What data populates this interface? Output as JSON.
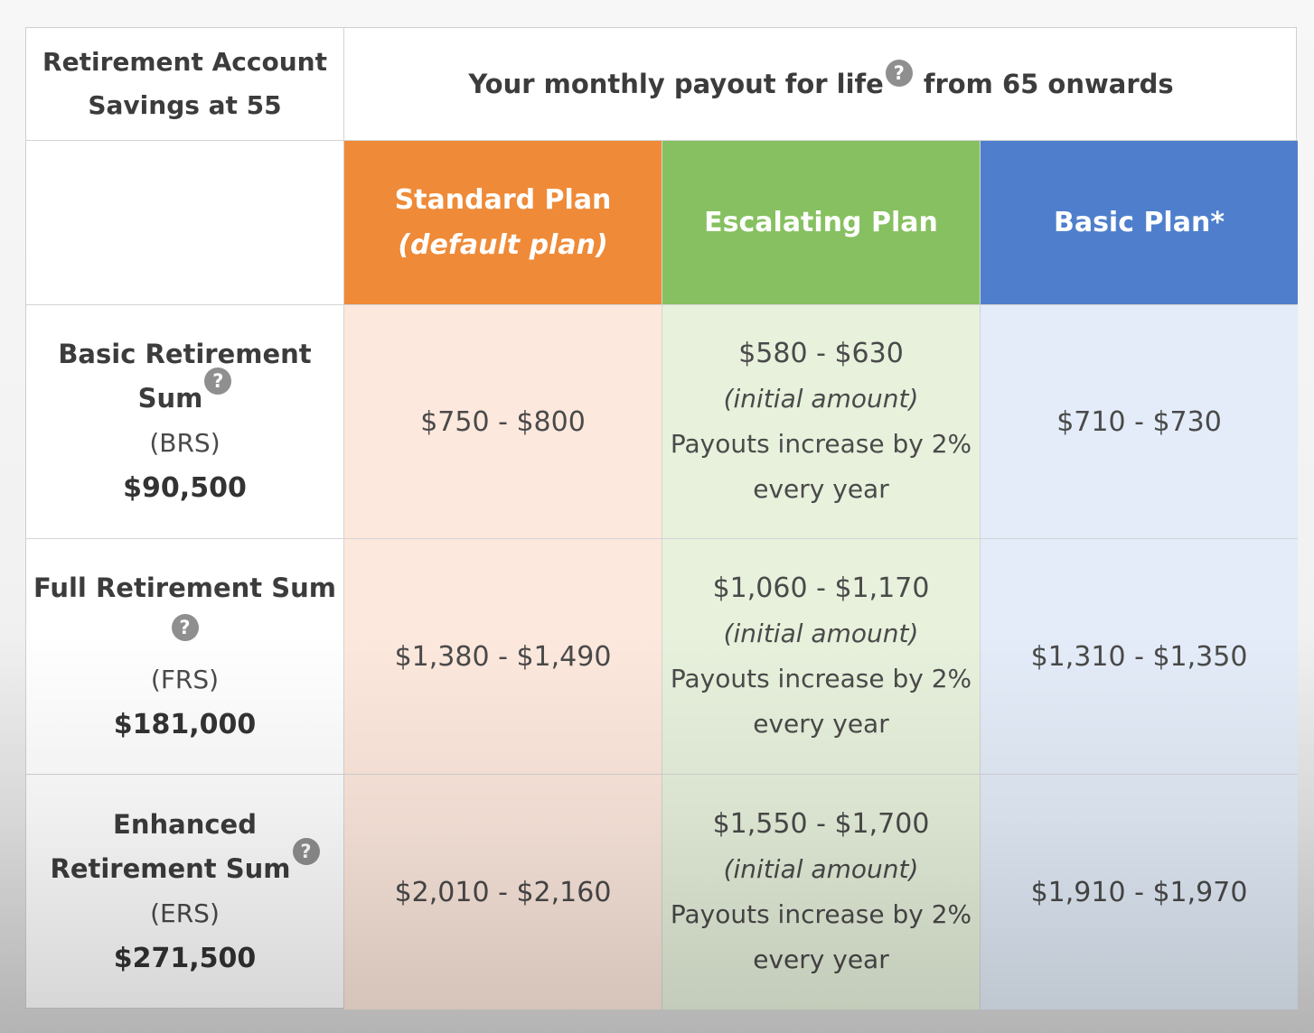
{
  "header": {
    "row_label_line1": "Retirement Account",
    "row_label_line2": "Savings at 55",
    "title_part1": "Your monthly payout for life",
    "title_part2": "from 65 onwards",
    "help_glyph": "?"
  },
  "plans": {
    "standard": {
      "name": "Standard Plan",
      "sub": "(default plan)",
      "color": "#ef8a38"
    },
    "escalating": {
      "name": "Escalating Plan",
      "color": "#87c060"
    },
    "basic": {
      "name": "Basic Plan*",
      "color": "#4f7fcc"
    }
  },
  "rows": [
    {
      "name_line1": "Basic Retirement",
      "name_line2": "Sum",
      "abbr": "(BRS)",
      "amount": "$90,500",
      "standard": "$750 - $800",
      "escalating_range": "$580 - $630",
      "escalating_note": "(initial amount)",
      "escalating_desc1": "Payouts increase by 2%",
      "escalating_desc2": "every year",
      "basic": "$710 - $730"
    },
    {
      "name_line1": "Full Retirement Sum",
      "abbr": "(FRS)",
      "amount": "$181,000",
      "standard": "$1,380 - $1,490",
      "escalating_range": "$1,060 - $1,170",
      "escalating_note": "(initial amount)",
      "escalating_desc1": "Payouts increase by 2%",
      "escalating_desc2": "every year",
      "basic": "$1,310 - $1,350"
    },
    {
      "name_line1": "Enhanced",
      "name_line2": "Retirement Sum",
      "abbr": "(ERS)",
      "amount": "$271,500",
      "standard": "$2,010 - $2,160",
      "escalating_range": "$1,550 - $1,700",
      "escalating_note": "(initial amount)",
      "escalating_desc1": "Payouts increase by 2%",
      "escalating_desc2": "every year",
      "basic": "$1,910 - $1,970"
    }
  ]
}
